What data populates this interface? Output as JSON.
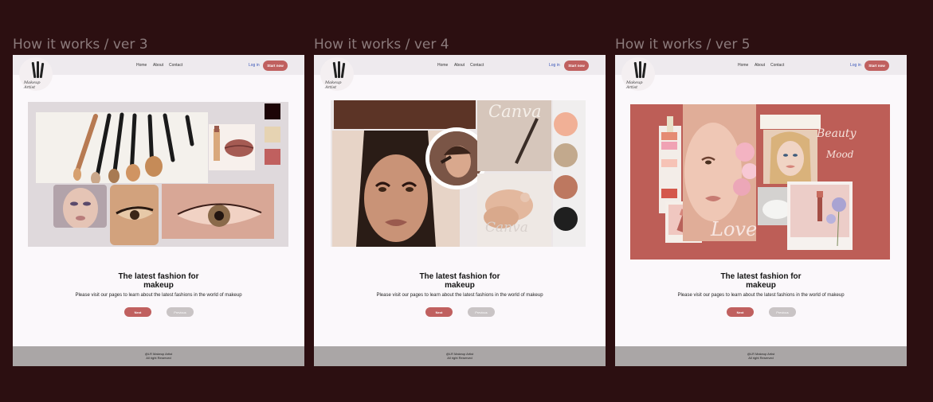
{
  "frames": [
    {
      "label": "How it works / ver 3",
      "nav": {
        "home": "Home",
        "about": "About",
        "contact": "Contact",
        "login": "Log in",
        "start": "Start now"
      },
      "logo_text": "Makeup Artist",
      "title_line1": "The latest fashion for",
      "title_line2": "makeup",
      "description": "Please visit our pages to learn about the latest fashions in the world of makeup",
      "next_label": "Next",
      "previous_label": "Previous",
      "footer_line1": "@LR Makeup Artist",
      "footer_line2": "All right Reserved",
      "swatches": [
        "#1c0507",
        "#e6d3b2",
        "#c0605f"
      ]
    },
    {
      "label": "How it works / ver 4",
      "nav": {
        "home": "Home",
        "about": "About",
        "contact": "Contact",
        "login": "Log in",
        "start": "Start now"
      },
      "logo_text": "Makeup Artist",
      "title_line1": "The latest fashion for",
      "title_line2": "makeup",
      "description": "Please visit our pages to learn about the latest fashions in the world of makeup",
      "next_label": "Next",
      "previous_label": "Previous",
      "footer_line1": "@LR Makeup Artist",
      "footer_line2": "All right Reserved",
      "canva_text": "Canva",
      "swatches": [
        "#f1b096",
        "#c2a98d",
        "#bd7860",
        "#1f1f1f"
      ]
    },
    {
      "label": "How it works / ver 5",
      "nav": {
        "home": "Home",
        "about": "About",
        "contact": "Contact",
        "login": "Log in",
        "start": "Start now"
      },
      "logo_text": "Makeup Artist",
      "title_line1": "The latest fashion for",
      "title_line2": "makeup",
      "description": "Please visit our pages to learn about the latest fashions in the world of makeup",
      "next_label": "Next",
      "previous_label": "Previous",
      "footer_line1": "@LR Makeup Artist",
      "footer_line2": "All right Reserved",
      "beauty_text": "Beauty",
      "mood_text": "Mood",
      "love_text": "Love",
      "swatches": [
        "#e58b73",
        "#f0a2b4",
        "#f6c3b6",
        "#d4574b"
      ]
    }
  ],
  "colors": {
    "background": "#2c0f11",
    "accent": "#c0605f",
    "footer": "#aaa6a6"
  }
}
